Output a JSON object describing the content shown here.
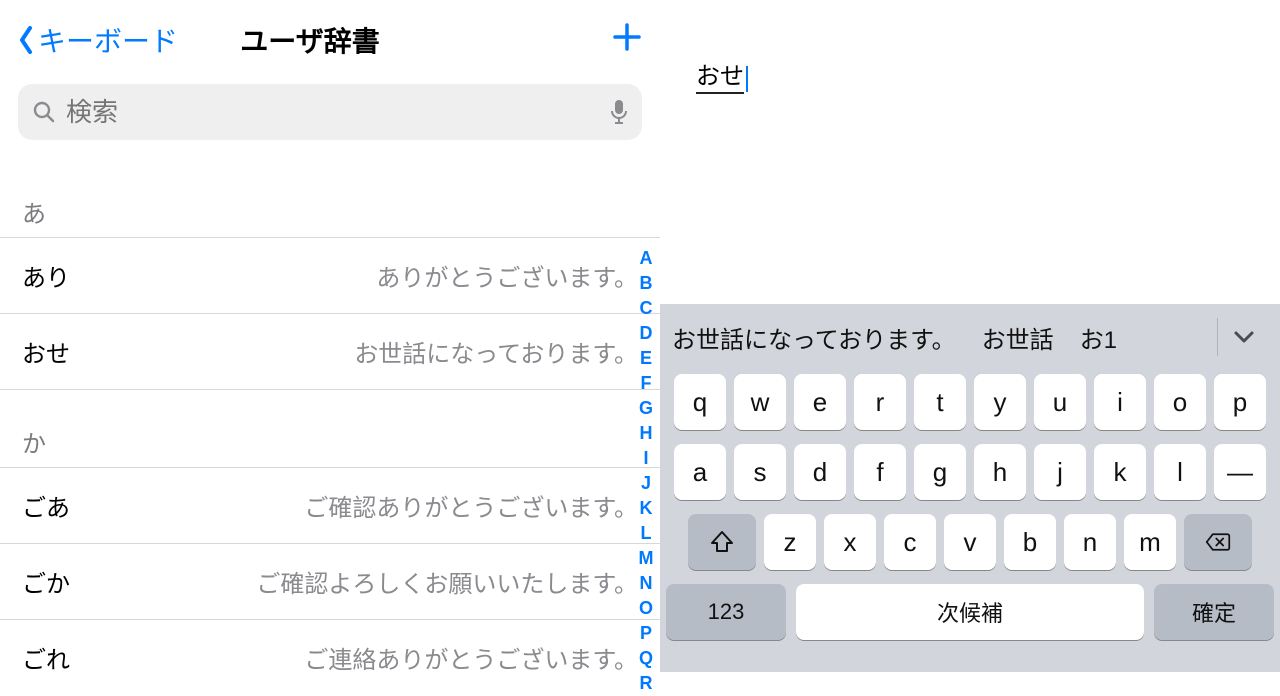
{
  "nav": {
    "back_label": "キーボード",
    "title": "ユーザ辞書"
  },
  "search": {
    "placeholder": "検索"
  },
  "sections": [
    {
      "header": "あ",
      "rows": [
        {
          "short": "あり",
          "long": "ありがとうございます。"
        },
        {
          "short": "おせ",
          "long": "お世話になっております。"
        }
      ]
    },
    {
      "header": "か",
      "rows": [
        {
          "short": "ごあ",
          "long": "ご確認ありがとうございます。"
        },
        {
          "short": "ごか",
          "long": "ご確認よろしくお願いいたします。"
        },
        {
          "short": "ごれ",
          "long": "ご連絡ありがとうございます。"
        }
      ]
    }
  ],
  "index_rail": [
    "A",
    "B",
    "C",
    "D",
    "E",
    "F",
    "G",
    "H",
    "I",
    "J",
    "K",
    "L",
    "M",
    "N",
    "O",
    "P",
    "Q",
    "R"
  ],
  "typed_text": "おせ",
  "candidates": [
    "お世話になっております。",
    "お世話",
    "お1"
  ],
  "keyboard": {
    "row1": [
      "q",
      "w",
      "e",
      "r",
      "t",
      "y",
      "u",
      "i",
      "o",
      "p"
    ],
    "row2": [
      "a",
      "s",
      "d",
      "f",
      "g",
      "h",
      "j",
      "k",
      "l",
      "—"
    ],
    "row3": [
      "z",
      "x",
      "c",
      "v",
      "b",
      "n",
      "m"
    ],
    "num_label": "123",
    "space_label": "次候補",
    "confirm_label": "確定"
  }
}
